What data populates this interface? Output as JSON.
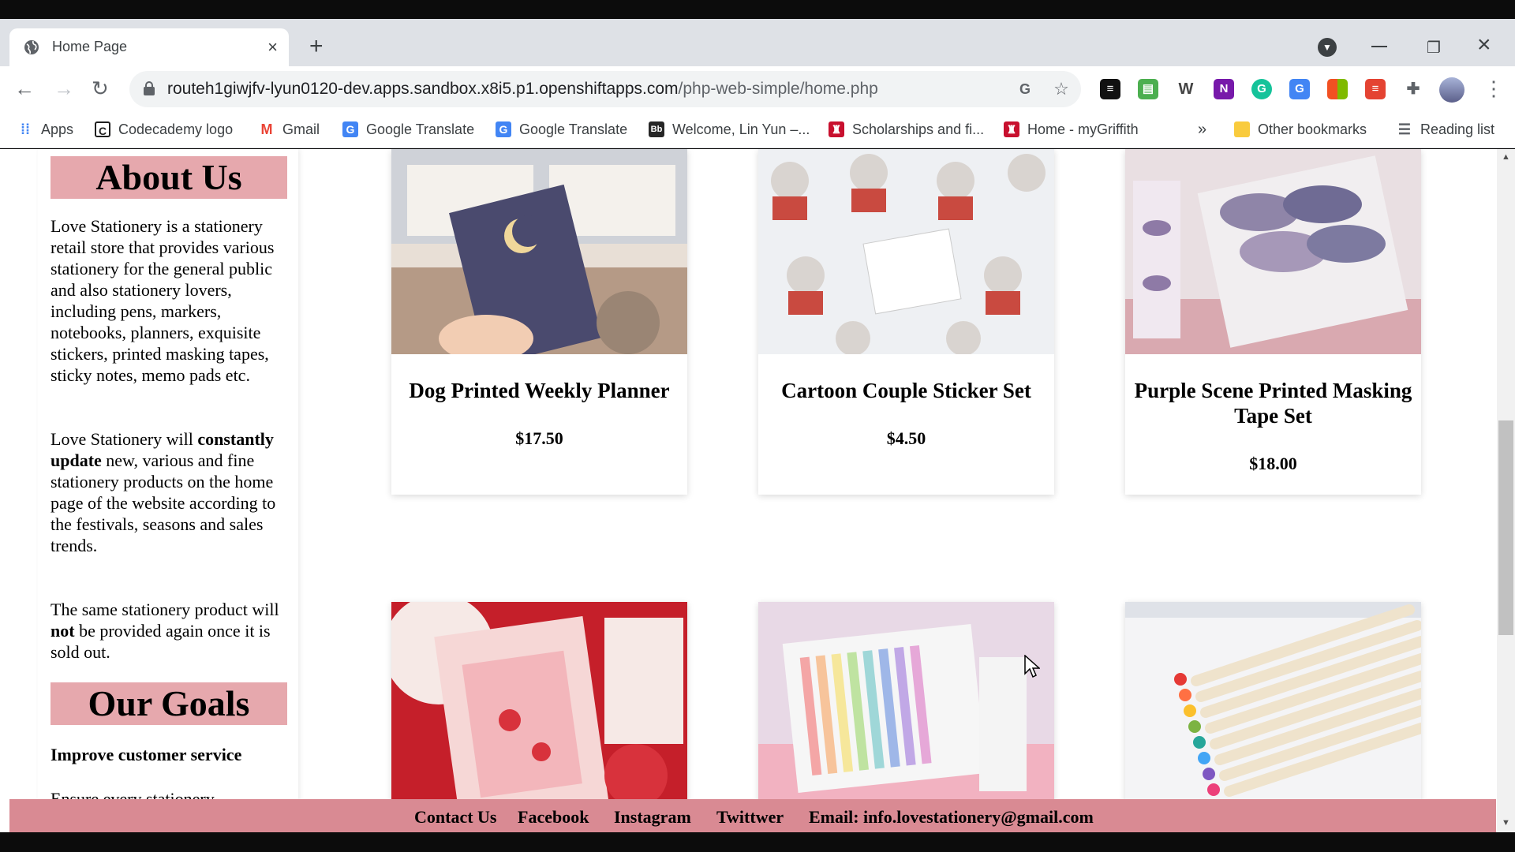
{
  "browser": {
    "tab_title": "Home Page",
    "tab_close": "×",
    "new_tab": "+",
    "url_host": "routeh1giwjfv-lyun0120-dev.apps.sandbox.x8i5.p1.openshiftapps.com",
    "url_path": "/php-web-simple/home.php",
    "bookmarks": [
      {
        "label": "Apps",
        "icon": "apps-grid-icon",
        "color": "#4285f4"
      },
      {
        "label": "Codecademy logo",
        "icon": "codecademy-icon",
        "color": "#1f1f1f"
      },
      {
        "label": "Gmail",
        "icon": "gmail-icon",
        "color": "#ea4335"
      },
      {
        "label": "Google Translate",
        "icon": "google-translate-icon",
        "color": "#4285f4"
      },
      {
        "label": "Google Translate",
        "icon": "google-translate-icon",
        "color": "#4285f4"
      },
      {
        "label": "Welcome, Lin Yun –...",
        "icon": "blackboard-icon",
        "color": "#262626"
      },
      {
        "label": "Scholarships and fi...",
        "icon": "griffith-icon",
        "color": "#c8102e"
      },
      {
        "label": "Home - myGriffith",
        "icon": "griffith-icon",
        "color": "#c8102e"
      }
    ],
    "bookmarks_overflow": "»",
    "other_bookmarks": "Other bookmarks",
    "reading_list": "Reading list"
  },
  "sidebar": {
    "about_title": "About Us",
    "about_p1": "Love Stationery is a stationery retail store that provides various stationery for the general public and also stationery lovers, including pens, markers, notebooks, planners, exquisite stickers, printed masking tapes, sticky notes, memo pads etc.",
    "about_p2_start": "Love Stationery will ",
    "about_p2_bold": "constantly update",
    "about_p2_end": " new, various and fine stationery products on the home page of the website according to the festivals, seasons and sales trends.",
    "about_p3_start": "The same stationery product will ",
    "about_p3_bold": "not",
    "about_p3_end": " be provided again once it is sold out.",
    "goals_title": "Our Goals",
    "goal1_title": "Improve customer service",
    "goal1_text": "Ensure every stationery"
  },
  "products": [
    {
      "name": "Dog Printed Weekly Planner",
      "price": "$17.50"
    },
    {
      "name": "Cartoon Couple Sticker Set",
      "price": "$4.50"
    },
    {
      "name": "Purple Scene Printed Masking Tape Set",
      "price": "$18.00"
    }
  ],
  "footer": {
    "contact": "Contact Us",
    "facebook": "Facebook",
    "instagram": "Instagram",
    "twitter": "Twittwer",
    "email": "Email: info.lovestationery@gmail.com"
  },
  "colors": {
    "section_title_bg": "#e6a8ad",
    "footer_bg": "#d98a93"
  }
}
